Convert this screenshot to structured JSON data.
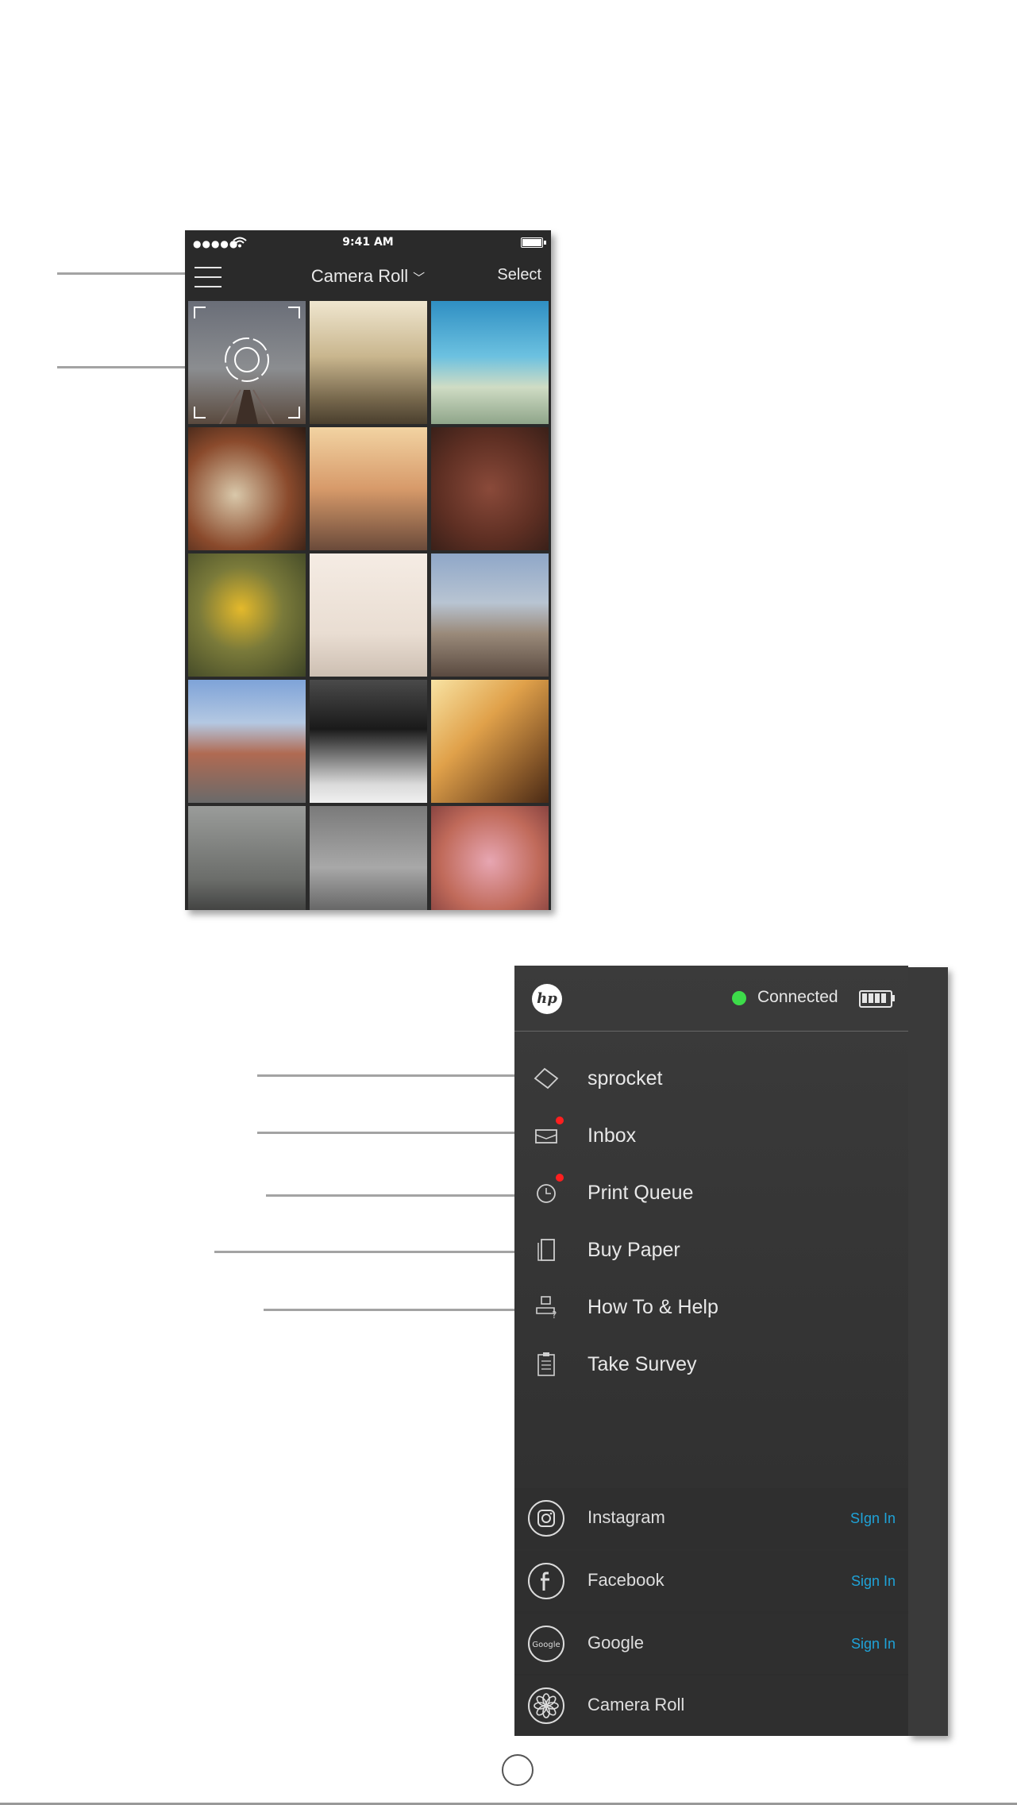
{
  "status_bar": {
    "signal": "●●●●●",
    "time": "9:41 AM"
  },
  "nav": {
    "title": "Camera Roll",
    "select_label": "Select"
  },
  "photo_grid": [
    "camera-tile",
    "hiker-mountain",
    "palm-beach-van",
    "sandwich",
    "friends-selfie",
    "beer-flight",
    "sunflower",
    "palm-trees",
    "railroad-tracks",
    "hotel-building",
    "camera-person",
    "woman-sunset",
    "tower-bridge",
    "dreamcatcher",
    "cupcakes"
  ],
  "menu": {
    "status": "Connected",
    "items": [
      {
        "label": "sprocket",
        "icon": "sprocket-icon"
      },
      {
        "label": "Inbox",
        "icon": "inbox-icon"
      },
      {
        "label": "Print Queue",
        "icon": "clock-icon"
      },
      {
        "label": "Buy Paper",
        "icon": "paper-icon"
      },
      {
        "label": "How To & Help",
        "icon": "help-icon"
      },
      {
        "label": "Take Survey",
        "icon": "survey-icon"
      }
    ],
    "social": [
      {
        "label": "Instagram",
        "action": "SIgn In"
      },
      {
        "label": "Facebook",
        "action": "Sign In"
      },
      {
        "label": "Google",
        "action": "Sign In"
      },
      {
        "label": "Camera Roll"
      }
    ],
    "google_icon_text": "Google"
  },
  "colors": {
    "accent_link": "#1fa3d8",
    "connected": "#3ddc4a",
    "badge": "#ff1f1f"
  }
}
